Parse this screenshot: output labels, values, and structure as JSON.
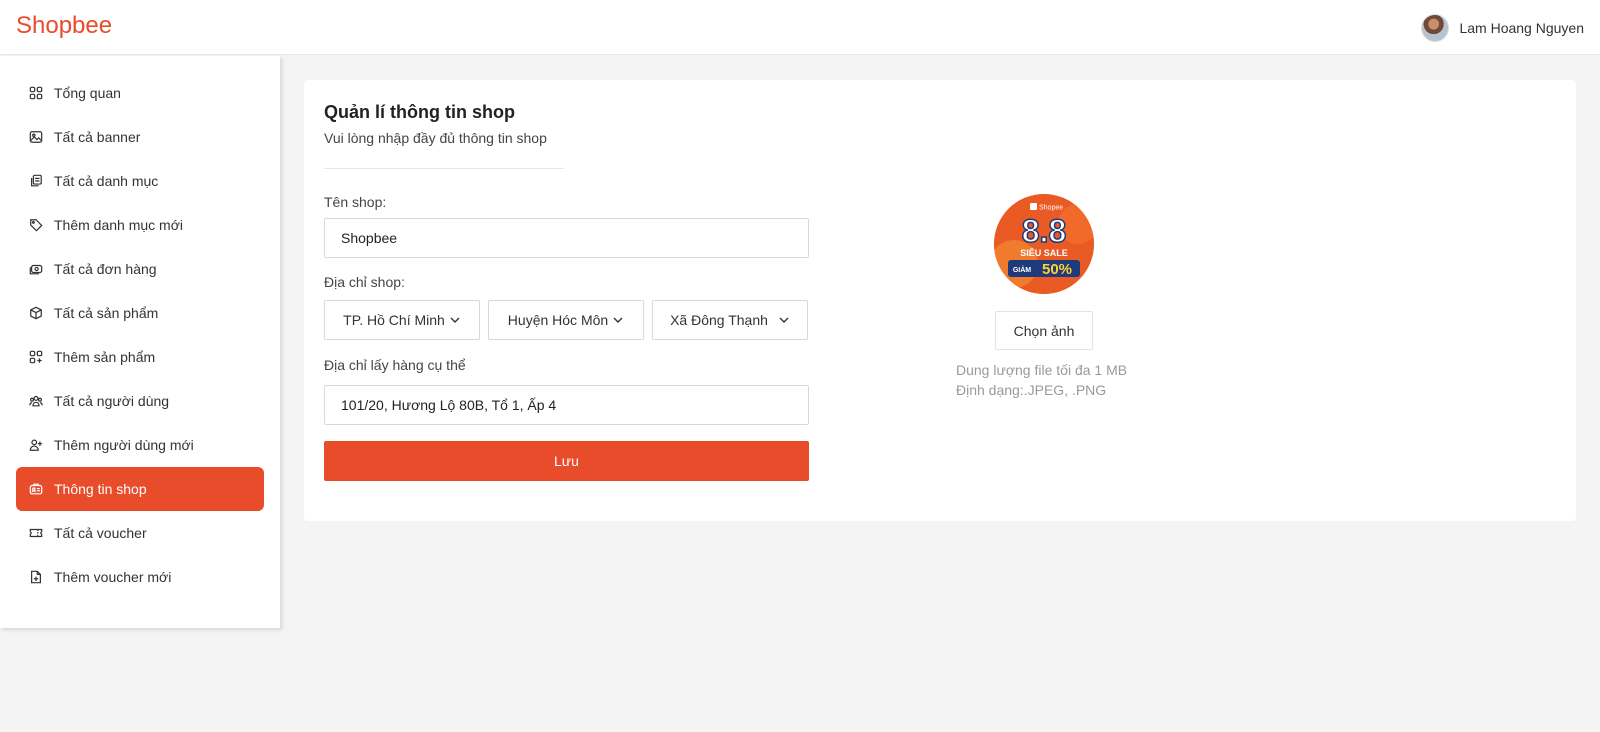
{
  "header": {
    "brand": "Shopbee",
    "user_name": "Lam Hoang Nguyen"
  },
  "sidebar": {
    "items": [
      {
        "label": "Tổng quan",
        "icon": "grid-icon",
        "active": false
      },
      {
        "label": "Tất cả banner",
        "icon": "image-icon",
        "active": false
      },
      {
        "label": "Tất cả danh mục",
        "icon": "copy-icon",
        "active": false
      },
      {
        "label": "Thêm danh mục mới",
        "icon": "tag-icon",
        "active": false
      },
      {
        "label": "Tất cả đơn hàng",
        "icon": "cash-icon",
        "active": false
      },
      {
        "label": "Tất cả sản phẩm",
        "icon": "box-icon",
        "active": false
      },
      {
        "label": "Thêm sản phẩm",
        "icon": "grid-add-icon",
        "active": false
      },
      {
        "label": "Tất cả người dùng",
        "icon": "users-icon",
        "active": false
      },
      {
        "label": "Thêm người dùng mới",
        "icon": "user-add-icon",
        "active": false
      },
      {
        "label": "Thông tin shop",
        "icon": "shop-id-icon",
        "active": true
      },
      {
        "label": "Tất cả voucher",
        "icon": "ticket-icon",
        "active": false
      },
      {
        "label": "Thêm voucher mới",
        "icon": "file-add-icon",
        "active": false
      }
    ]
  },
  "main": {
    "title": "Quản lí thông tin shop",
    "subtitle": "Vui lòng nhập đầy đủ thông tin shop",
    "shop_name": {
      "label": "Tên shop:",
      "value": "Shopbee"
    },
    "address": {
      "label": "Địa chỉ shop:",
      "province": "TP. Hồ Chí Minh",
      "district": "Huyện Hóc Môn",
      "ward": "Xã Đông Thạnh"
    },
    "pickup": {
      "label": "Địa chỉ lấy hàng cụ thể",
      "value": "101/20, Hương Lộ 80B, Tổ 1, Ấp 4"
    },
    "save_label": "Lưu",
    "logo": {
      "brand_text": "Shopee",
      "big_text": "8.8",
      "sale_text": "SIÊU SALE",
      "discount_prefix": "GIẢM",
      "discount_value": "50%"
    },
    "choose_image_label": "Chọn ảnh",
    "hint_size": "Dung lượng file tối đa 1 MB",
    "hint_format": "Định dạng:.JPEG, .PNG"
  },
  "colors": {
    "accent": "#e84c2b",
    "background": "#f4f4f4"
  }
}
